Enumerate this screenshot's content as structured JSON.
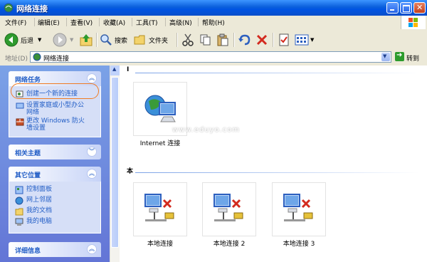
{
  "window": {
    "title": "网络连接"
  },
  "menu": [
    "文件(F)",
    "编辑(E)",
    "查看(V)",
    "收藏(A)",
    "工具(T)",
    "高级(N)",
    "帮助(H)"
  ],
  "toolbar": {
    "back_label": "后退",
    "search_label": "搜索",
    "folders_label": "文件夹"
  },
  "address": {
    "label": "地址(D)",
    "value": "网络连接",
    "go_label": "转到"
  },
  "sidebar": {
    "network_tasks": {
      "title": "网络任务",
      "items": [
        {
          "label": "创建一个新的连接"
        },
        {
          "label_line1": "设置家庭或小型办公",
          "label_line2": "网络"
        },
        {
          "label_line1": "更改 Windows 防火",
          "label_line2": "墙设置"
        }
      ]
    },
    "related_topics": {
      "title": "相关主题"
    },
    "other_places": {
      "title": "其它位置",
      "items": [
        "控制面板",
        "网上邻居",
        "我的文档",
        "我的电脑"
      ]
    },
    "details": {
      "title": "详细信息"
    }
  },
  "main": {
    "groups": [
      {
        "title": "I",
        "items": [
          "Internet 连接"
        ]
      },
      {
        "title": "本",
        "items": [
          "本地连接",
          "本地连接 2",
          "本地连接 3"
        ]
      }
    ]
  },
  "watermark": "www.eduyo.com",
  "colors": {
    "accent": "#215dc6",
    "highlight": "#f07b22",
    "titlebar": "#0054e3"
  }
}
